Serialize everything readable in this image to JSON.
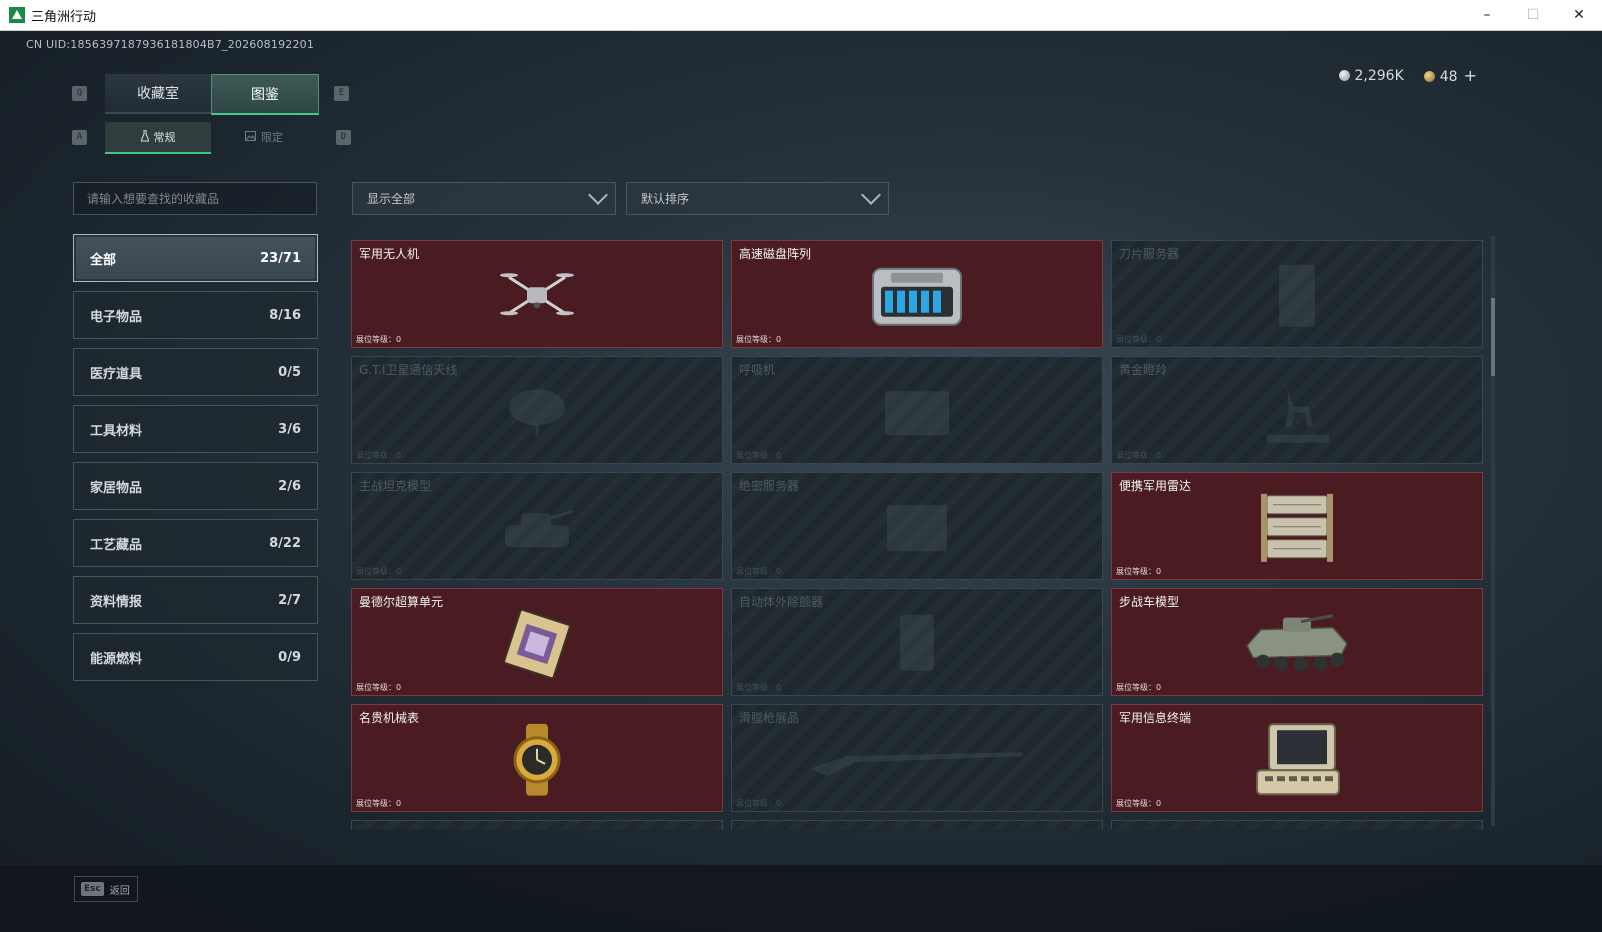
{
  "window": {
    "title": "三角洲行动",
    "minimize": "–",
    "maximize": "☐",
    "close": "✕"
  },
  "uid": "CN UID:1856397187936181804B7_202608192201",
  "currency": {
    "silver": "2,296K",
    "gold": "48",
    "add": "+"
  },
  "keys": {
    "prev_main": "Q",
    "next_main": "E",
    "prev_sub": "A",
    "next_sub": "D"
  },
  "tabs": [
    {
      "label": "收藏室"
    },
    {
      "label": "图鉴"
    }
  ],
  "subtabs": [
    {
      "label": "常规"
    },
    {
      "label": "限定"
    }
  ],
  "search": {
    "placeholder": "请输入想要查找的收藏品"
  },
  "filters": {
    "display": "显示全部",
    "sort": "默认排序"
  },
  "categories": [
    {
      "label": "全部",
      "count": "23/71"
    },
    {
      "label": "电子物品",
      "count": "8/16"
    },
    {
      "label": "医疗道具",
      "count": "0/5"
    },
    {
      "label": "工具材料",
      "count": "3/6"
    },
    {
      "label": "家居物品",
      "count": "2/6"
    },
    {
      "label": "工艺藏品",
      "count": "8/22"
    },
    {
      "label": "资料情报",
      "count": "2/7"
    },
    {
      "label": "能源燃料",
      "count": "0/9"
    }
  ],
  "items": [
    {
      "name": "军用无人机",
      "level": "展位等级：0",
      "owned": true,
      "icon": "drone"
    },
    {
      "name": "高速磁盘阵列",
      "level": "展位等级：0",
      "owned": true,
      "icon": "disk-array"
    },
    {
      "name": "刀片服务器",
      "level": "展位等级：0",
      "owned": false,
      "icon": "blade-server"
    },
    {
      "name": "G.T.I卫星通信天线",
      "level": "展位等级：0",
      "owned": false,
      "icon": "satellite-dish"
    },
    {
      "name": "呼吸机",
      "level": "展位等级：0",
      "owned": false,
      "icon": "ventilator"
    },
    {
      "name": "黄金瞪羚",
      "level": "展位等级：0",
      "owned": false,
      "icon": "gazelle"
    },
    {
      "name": "主战坦克模型",
      "level": "展位等级：0",
      "owned": false,
      "icon": "tank"
    },
    {
      "name": "绝密服务器",
      "level": "展位等级：0",
      "owned": false,
      "icon": "server"
    },
    {
      "name": "便携军用雷达",
      "level": "展位等级：0",
      "owned": true,
      "icon": "radar"
    },
    {
      "name": "曼德尔超算单元",
      "level": "展位等级：0",
      "owned": true,
      "icon": "chip"
    },
    {
      "name": "自动体外除颤器",
      "level": "展位等级：0",
      "owned": false,
      "icon": "defibrillator"
    },
    {
      "name": "步战车模型",
      "level": "展位等级：0",
      "owned": true,
      "icon": "ifv"
    },
    {
      "name": "名贵机械表",
      "level": "展位等级：0",
      "owned": true,
      "icon": "watch"
    },
    {
      "name": "滑膛枪展品",
      "level": "展位等级：0",
      "owned": false,
      "icon": "musket"
    },
    {
      "name": "军用信息终端",
      "level": "展位等级：0",
      "owned": true,
      "icon": "terminal"
    }
  ],
  "footer": {
    "esc_key": "Esc",
    "esc_label": "返回"
  }
}
